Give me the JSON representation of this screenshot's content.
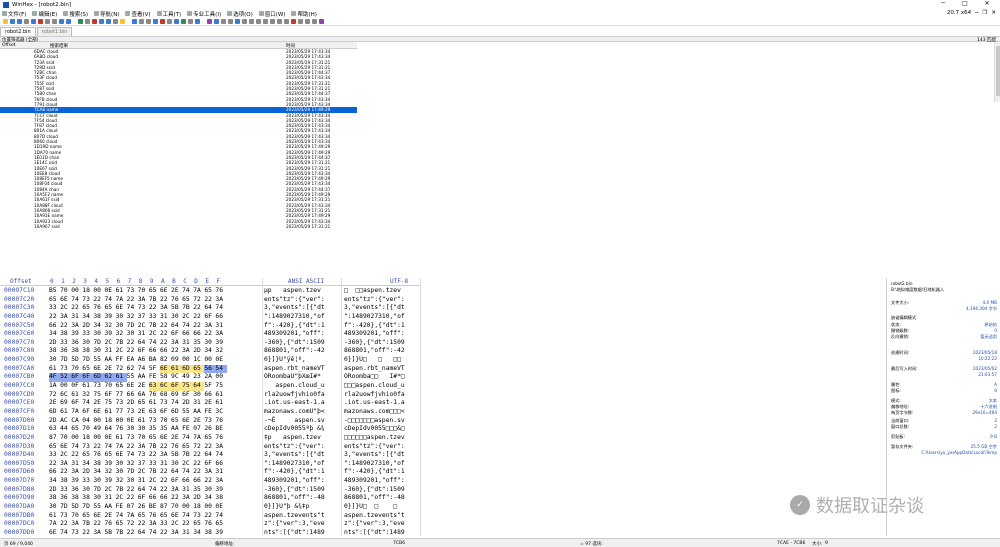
{
  "window": {
    "title": "WinHex - [robot2.bin]"
  },
  "menu": {
    "items": [
      "文件(F)",
      "编辑(E)",
      "搜索(S)",
      "导航(N)",
      "查看(V)",
      "工具(T)",
      "专业工具(I)",
      "选项(O)",
      "窗口(W)",
      "帮助(H)"
    ],
    "version": "20.7 x64"
  },
  "tabs": [
    "robot2.bin",
    "robot1.bin"
  ],
  "infobar": {
    "left": "位置筛选器 (全部)",
    "count": "143 匹配"
  },
  "filelist": {
    "headers": {
      "offset": "Offset",
      "name": "搜索结果",
      "time": "时间"
    },
    "rows": [
      [
        "6DAC cloud",
        "2023/05/29 17:43:34"
      ],
      [
        "6A8D cloud",
        "2023/05/29 17:43:34"
      ],
      [
        "723A ssid",
        "2023/05/29 17:31:21"
      ],
      [
        "729D ssid",
        "2023/05/29 17:31:21"
      ],
      [
        "72BC chan",
        "2023/05/29 17:44:37"
      ],
      [
        "753F cloud",
        "2023/05/29 17:43:34"
      ],
      [
        "755F ssid",
        "2023/05/29 17:31:21"
      ],
      [
        "7587 ssid",
        "2023/05/29 17:31:21"
      ],
      [
        "75B0 chan",
        "2023/05/29 17:44:37"
      ],
      [
        "76FB cloud",
        "2023/05/29 17:43:34"
      ],
      [
        "7791 cloud",
        "2023/05/29 17:43:34"
      ],
      [
        "7CA8 name",
        "2023/05/29 17:49:29"
      ],
      [
        "7CCF cloud",
        "2023/05/29 17:43:34"
      ],
      [
        "7F54 cloud",
        "2023/05/29 17:43:34"
      ],
      [
        "7F87 cloud",
        "2023/05/29 17:43:34"
      ],
      [
        "801A cloud",
        "2023/05/29 17:43:34"
      ],
      [
        "807D cloud",
        "2023/05/29 17:43:34"
      ],
      [
        "8060 cloud",
        "2023/05/29 17:43:34"
      ],
      [
        "1D19D name",
        "2023/05/29 17:49:29"
      ],
      [
        "1DA70 name",
        "2023/05/29 17:49:29"
      ],
      [
        "1E01D chan",
        "2023/05/29 17:44:37"
      ],
      [
        "1E14C ssid",
        "2023/05/29 17:31:21"
      ],
      [
        "10E67 ssid",
        "2023/05/29 17:31:21"
      ],
      [
        "10EE8 cloud",
        "2023/05/29 17:43:34"
      ],
      [
        "108EF5 name",
        "2023/05/29 17:49:29"
      ],
      [
        "108F04 cloud",
        "2023/05/29 17:43:34"
      ],
      [
        "1084A chan",
        "2023/05/29 17:44:37"
      ],
      [
        "10A5F2 name",
        "2023/05/29 17:49:29"
      ],
      [
        "10A61F ssid",
        "2023/05/29 17:31:21"
      ],
      [
        "10A88F cloud",
        "2023/05/29 17:43:34"
      ],
      [
        "10A808 ssid",
        "2023/05/29 17:31:21"
      ],
      [
        "10A91E name",
        "2023/05/29 17:49:29"
      ],
      [
        "10A923 cloud",
        "2023/05/29 17:43:34"
      ],
      [
        "10A907 ssid",
        "2023/05/29 17:31:21"
      ]
    ]
  },
  "hex": {
    "header_offset": "Offset",
    "header_cols": [
      "0",
      "1",
      "2",
      "3",
      "4",
      "5",
      "6",
      "7",
      "8",
      "9",
      "A",
      "B",
      "C",
      "D",
      "E",
      "F"
    ],
    "header_ansi": "ANSI ASCII",
    "header_utf": "UTF-8",
    "rows": [
      {
        "off": "00007C10",
        "bytes": [
          "B5",
          "70",
          "00",
          "18",
          "00",
          "0E",
          "61",
          "73",
          "70",
          "65",
          "6E",
          "2E",
          "74",
          "7A",
          "65",
          "76"
        ],
        "ansi": "µp   aspen.tzev",
        "utf": "□  □□aspen.tzev"
      },
      {
        "off": "00007C20",
        "bytes": [
          "65",
          "6E",
          "74",
          "73",
          "22",
          "74",
          "7A",
          "22",
          "3A",
          "7B",
          "22",
          "76",
          "65",
          "72",
          "22",
          "3A"
        ],
        "ansi": "ents\"tz\":{\"ver\":",
        "utf": "ents\"tz\":{\"ver\":"
      },
      {
        "off": "00007C30",
        "bytes": [
          "33",
          "2C",
          "22",
          "65",
          "76",
          "65",
          "6E",
          "74",
          "73",
          "22",
          "3A",
          "5B",
          "7B",
          "22",
          "64",
          "74"
        ],
        "ansi": "3,\"events\":[{\"dt",
        "utf": "3,\"events\":[{\"dt"
      },
      {
        "off": "00007C40",
        "bytes": [
          "22",
          "3A",
          "31",
          "34",
          "38",
          "39",
          "30",
          "32",
          "37",
          "33",
          "31",
          "30",
          "2C",
          "22",
          "6F",
          "66"
        ],
        "ansi": "\":1489027310,\"of",
        "utf": "\":1489027310,\"of"
      },
      {
        "off": "00007C50",
        "bytes": [
          "66",
          "22",
          "3A",
          "2D",
          "34",
          "32",
          "30",
          "7D",
          "2C",
          "7B",
          "22",
          "64",
          "74",
          "22",
          "3A",
          "31"
        ],
        "ansi": "f\":-420},{\"dt\":1",
        "utf": "f\":-420},{\"dt\":1"
      },
      {
        "off": "00007C60",
        "bytes": [
          "34",
          "38",
          "39",
          "33",
          "30",
          "39",
          "32",
          "30",
          "31",
          "2C",
          "22",
          "6F",
          "66",
          "66",
          "22",
          "3A"
        ],
        "ansi": "489309201,\"off\":",
        "utf": "489309201,\"off\":"
      },
      {
        "off": "00007C70",
        "bytes": [
          "2D",
          "33",
          "36",
          "30",
          "7D",
          "2C",
          "7B",
          "22",
          "64",
          "74",
          "22",
          "3A",
          "31",
          "35",
          "30",
          "39"
        ],
        "ansi": "-360},{\"dt\":1509",
        "utf": "-360},{\"dt\":1509"
      },
      {
        "off": "00007C80",
        "bytes": [
          "38",
          "36",
          "38",
          "38",
          "30",
          "31",
          "2C",
          "22",
          "6F",
          "66",
          "66",
          "22",
          "3A",
          "2D",
          "34",
          "32"
        ],
        "ansi": "868801,\"off\":-42",
        "utf": "868801,\"off\":-42"
      },
      {
        "off": "00007C90",
        "bytes": [
          "30",
          "7D",
          "5D",
          "7D",
          "55",
          "AA",
          "FF",
          "EA",
          "A6",
          "BA",
          "82",
          "09",
          "00",
          "1C",
          "00",
          "0E"
        ],
        "ansi": "0}]}U\"ÿê¦º‚",
        "utf": "0}]}U□   □   □□"
      },
      {
        "off": "00007CA0",
        "bytes": [
          "61",
          "73",
          "70",
          "65",
          "6E",
          "2E",
          "72",
          "62",
          "74",
          "5F",
          "6E",
          "61",
          "6D",
          "65",
          "56",
          "54"
        ],
        "ansi": "aspen.rbt_nameVT",
        "utf": "aspen.rbt_nameVT",
        "hl": [
          10,
          11,
          12,
          13
        ],
        "hlb": [
          14,
          15
        ]
      },
      {
        "off": "00007CB0",
        "bytes": [
          "4F",
          "52",
          "6F",
          "6F",
          "6D",
          "62",
          "61",
          "55",
          "AA",
          "FE",
          "58",
          "9C",
          "49",
          "23",
          "2A",
          "00"
        ],
        "ansi": "ORoombaU\"þXœI#*",
        "utf": "ORoomba□□   I#*□",
        "hlb": [
          0,
          1,
          2,
          3,
          4,
          5,
          6
        ]
      },
      {
        "off": "00007CC0",
        "bytes": [
          "1A",
          "00",
          "0F",
          "61",
          "73",
          "70",
          "65",
          "6E",
          "2E",
          "63",
          "6C",
          "6F",
          "75",
          "64",
          "5F",
          "75"
        ],
        "ansi": "   aspen.cloud_u",
        "utf": "□□□aspen.cloud_u",
        "hl": [
          9,
          10,
          11,
          12,
          13
        ]
      },
      {
        "off": "00007CD0",
        "bytes": [
          "72",
          "6C",
          "61",
          "32",
          "75",
          "6F",
          "77",
          "66",
          "6A",
          "76",
          "68",
          "69",
          "6F",
          "30",
          "66",
          "61"
        ],
        "ansi": "rla2uowfjvhio0fa",
        "utf": "rla2uowfjvhio0fa"
      },
      {
        "off": "00007CE0",
        "bytes": [
          "2E",
          "69",
          "6F",
          "74",
          "2E",
          "75",
          "73",
          "2D",
          "65",
          "61",
          "73",
          "74",
          "2D",
          "31",
          "2E",
          "61"
        ],
        "ansi": ".iot.us-east-1.a",
        "utf": ".iot.us-east-1.a"
      },
      {
        "off": "00007CF0",
        "bytes": [
          "6D",
          "61",
          "7A",
          "6F",
          "6E",
          "61",
          "77",
          "73",
          "2E",
          "63",
          "6F",
          "6D",
          "55",
          "AA",
          "FE",
          "3C"
        ],
        "ansi": "mazonaws.comU\"þ<",
        "utf": "mazonaws.com□□□<"
      },
      {
        "off": "00007D00",
        "bytes": [
          "2D",
          "AC",
          "CA",
          "04",
          "00",
          "18",
          "00",
          "0E",
          "61",
          "73",
          "70",
          "65",
          "6E",
          "2E",
          "73",
          "76"
        ],
        "ansi": "-¬Ê     aspen.sv",
        "utf": "-□□□□□□□aspen.sv"
      },
      {
        "off": "00007D10",
        "bytes": [
          "63",
          "44",
          "65",
          "70",
          "49",
          "64",
          "76",
          "30",
          "30",
          "35",
          "35",
          "AA",
          "FE",
          "07",
          "26",
          "BE"
        ],
        "ansi": "cDepIdv0055ªþ &¾",
        "utf": "cDepIdv0055□□□&□"
      },
      {
        "off": "00007D20",
        "bytes": [
          "87",
          "70",
          "00",
          "18",
          "00",
          "0E",
          "61",
          "73",
          "70",
          "65",
          "6E",
          "2E",
          "74",
          "7A",
          "65",
          "76"
        ],
        "ansi": "‡p   aspen.tzev",
        "utf": "□□□□□□aspen.tzev"
      },
      {
        "off": "00007D30",
        "bytes": [
          "65",
          "6E",
          "74",
          "73",
          "22",
          "74",
          "7A",
          "22",
          "3A",
          "7B",
          "22",
          "76",
          "65",
          "72",
          "22",
          "3A"
        ],
        "ansi": "ents\"tz\":{\"ver\":",
        "utf": "ents\"tz\":{\"ver\":"
      },
      {
        "off": "00007D40",
        "bytes": [
          "33",
          "2C",
          "22",
          "65",
          "76",
          "65",
          "6E",
          "74",
          "73",
          "22",
          "3A",
          "5B",
          "7B",
          "22",
          "64",
          "74"
        ],
        "ansi": "3,\"events\":[{\"dt",
        "utf": "3,\"events\":[{\"dt"
      },
      {
        "off": "00007D50",
        "bytes": [
          "22",
          "3A",
          "31",
          "34",
          "38",
          "39",
          "30",
          "32",
          "37",
          "33",
          "31",
          "30",
          "2C",
          "22",
          "6F",
          "66"
        ],
        "ansi": "\":1489027310,\"of",
        "utf": "\":1489027310,\"of"
      },
      {
        "off": "00007D60",
        "bytes": [
          "66",
          "22",
          "3A",
          "2D",
          "34",
          "32",
          "30",
          "7D",
          "2C",
          "7B",
          "22",
          "64",
          "74",
          "22",
          "3A",
          "31"
        ],
        "ansi": "f\":-420},{\"dt\":1",
        "utf": "f\":-420},{\"dt\":1"
      },
      {
        "off": "00007D70",
        "bytes": [
          "34",
          "38",
          "39",
          "33",
          "30",
          "39",
          "32",
          "30",
          "31",
          "2C",
          "22",
          "6F",
          "66",
          "66",
          "22",
          "3A"
        ],
        "ansi": "489309201,\"off\":",
        "utf": "489309201,\"off\":"
      },
      {
        "off": "00007D80",
        "bytes": [
          "2D",
          "33",
          "36",
          "30",
          "7D",
          "2C",
          "7B",
          "22",
          "64",
          "74",
          "22",
          "3A",
          "31",
          "35",
          "30",
          "39"
        ],
        "ansi": "-360},{\"dt\":1509",
        "utf": "-360},{\"dt\":1509"
      },
      {
        "off": "00007D90",
        "bytes": [
          "38",
          "36",
          "38",
          "38",
          "30",
          "31",
          "2C",
          "22",
          "6F",
          "66",
          "66",
          "22",
          "3A",
          "2D",
          "34",
          "38"
        ],
        "ansi": "868801,\"off\":-48",
        "utf": "868801,\"off\":-48"
      },
      {
        "off": "00007DA0",
        "bytes": [
          "30",
          "7D",
          "5D",
          "7D",
          "55",
          "AA",
          "FE",
          "07",
          "26",
          "BE",
          "87",
          "70",
          "00",
          "18",
          "00",
          "0E"
        ],
        "ansi": "0}]}U\"þ &¾‡p",
        "utf": "0}]}U□  □    □"
      },
      {
        "off": "00007DB0",
        "bytes": [
          "61",
          "73",
          "70",
          "65",
          "6E",
          "2E",
          "74",
          "7A",
          "65",
          "76",
          "65",
          "6E",
          "74",
          "73",
          "22",
          "74"
        ],
        "ansi": "aspen.tzevents\"t",
        "utf": "aspen.tzevents\"t"
      },
      {
        "off": "00007DC0",
        "bytes": [
          "7A",
          "22",
          "3A",
          "7B",
          "22",
          "76",
          "65",
          "72",
          "22",
          "3A",
          "33",
          "2C",
          "22",
          "65",
          "76",
          "65"
        ],
        "ansi": "z\":{\"ver\":3,\"eve",
        "utf": "z\":{\"ver\":3,\"eve"
      },
      {
        "off": "00007DD0",
        "bytes": [
          "6E",
          "74",
          "73",
          "22",
          "3A",
          "5B",
          "7B",
          "22",
          "64",
          "74",
          "22",
          "3A",
          "31",
          "34",
          "38",
          "39"
        ],
        "ansi": "nts\":[{\"dt\":1489",
        "utf": "nts\":[{\"dt\":1489"
      }
    ]
  },
  "rightpanel": {
    "file": "robot2.bin",
    "path": "B:\\地狱难度数据\\扫地机器人",
    "rows": [
      [
        "文件大小:",
        "4.0 MB"
      ],
      [
        "",
        "4,194,304 字节"
      ],
      [
        "缺省编辑模式",
        ""
      ],
      [
        "状态:",
        "原始的"
      ],
      [
        "撤销级数:",
        "0"
      ],
      [
        "反向撤销:",
        "暂无适用"
      ],
      [
        "创建时间:",
        "2023/05/18"
      ],
      [
        "",
        "10:22:22"
      ],
      [
        "最后写入时间:",
        "2023/05/02"
      ],
      [
        "",
        "21:03:57"
      ],
      [
        "属性:",
        "A"
      ],
      [
        "图标:",
        "0"
      ],
      [
        "模式:",
        "文本"
      ],
      [
        "偏移地址:",
        "十六进制"
      ],
      [
        "每页字节数:",
        "29x16=464"
      ],
      [
        "当前窗口:",
        "2"
      ],
      [
        "窗口总数:",
        "2"
      ],
      [
        "剪贴板:",
        "9 B"
      ],
      [
        "暂存文件夹:",
        "25.5 GB 空余"
      ],
      [
        "",
        "C:\\Users\\yu_ya\\AppData\\Local\\Temp"
      ]
    ]
  },
  "watermark": {
    "text": "数据取证杂谈"
  },
  "statusbar": {
    "page": "页 69 / 9,040",
    "offset_label": "偏移地址:",
    "offset_value": "7CB6",
    "value": "= 97 选块:",
    "block": "7CAE - 7CB6",
    "size_label": "大小:",
    "size": "9"
  }
}
